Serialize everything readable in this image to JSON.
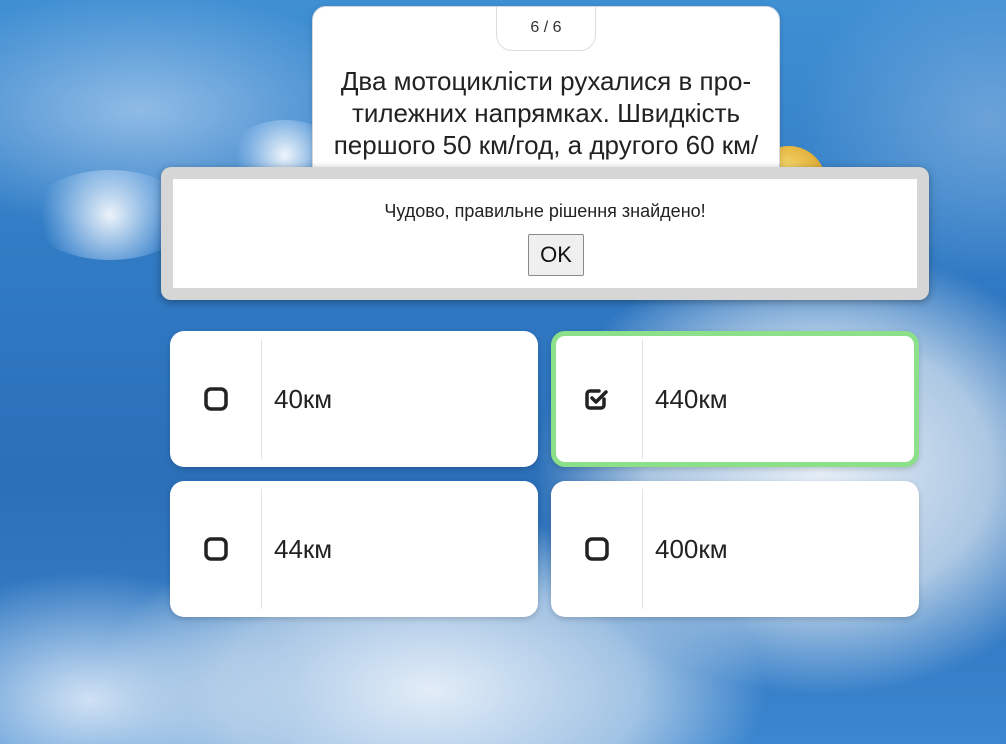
{
  "quiz": {
    "counter": "6 / 6",
    "question": "Два мотоциклісти рухалися в про-тилежних напрямках. Швидкість першого 50 км/год, а другого 60 км/год. Яка відстань між ними"
  },
  "dialog": {
    "message": "Чудово, правильне рішення знайдено!",
    "ok_label": "OK"
  },
  "answers": [
    {
      "label": "40км",
      "checked": false,
      "icon": "checkbox-empty-icon"
    },
    {
      "label": "440км",
      "checked": true,
      "icon": "checkbox-checked-icon"
    },
    {
      "label": "44км",
      "checked": false,
      "icon": "checkbox-empty-icon"
    },
    {
      "label": "400км",
      "checked": false,
      "icon": "checkbox-empty-icon"
    }
  ],
  "colors": {
    "selected_border": "#8de08a",
    "background_sky": "#2f78c2"
  }
}
